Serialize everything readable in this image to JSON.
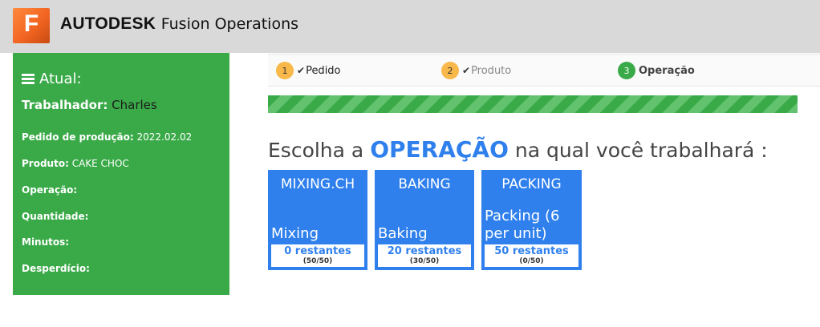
{
  "app": {
    "logo_letter": "F",
    "brand_strong": "AUTODESK",
    "brand_light": "Fusion Operations"
  },
  "sidebar": {
    "title": "Atual:",
    "worker_label": "Trabalhador",
    "worker_sep": ":",
    "worker_value": "Charles",
    "rows": [
      {
        "label": "Pedido de produção:",
        "value": "2022.02.02"
      },
      {
        "label": "Produto:",
        "value": "CAKE CHOC"
      },
      {
        "label": "Operação:",
        "value": ""
      },
      {
        "label": "Quantidade:",
        "value": ""
      },
      {
        "label": "Minutos:",
        "value": ""
      },
      {
        "label": "Desperdício:",
        "value": ""
      }
    ]
  },
  "steps": [
    {
      "number": "1",
      "label": "Pedido",
      "checked": true
    },
    {
      "number": "2",
      "label": "Produto",
      "checked": true
    },
    {
      "number": "3",
      "label": "Operação",
      "checked": false
    }
  ],
  "progress": {
    "percent": 100
  },
  "heading": {
    "prefix": "Escolha a",
    "accent": "OPERAÇÃO",
    "suffix": "na qual você trabalhará :"
  },
  "operations": [
    {
      "code": "MIXING.CH",
      "name": "Mixing",
      "remaining": "0 restantes",
      "fraction": "(50/50)"
    },
    {
      "code": "BAKING",
      "name": "Baking",
      "remaining": "20 restantes",
      "fraction": "(30/50)"
    },
    {
      "code": "PACKING",
      "name": "Packing (6 per unit)",
      "remaining": "50 restantes",
      "fraction": "(0/50)"
    }
  ],
  "colors": {
    "accent_blue": "#2f80ed",
    "sidebar_green": "#3aaa48",
    "step_orange": "#f8b84a",
    "logo_orange": "#f26522",
    "header_gray": "#d9d9d9"
  }
}
